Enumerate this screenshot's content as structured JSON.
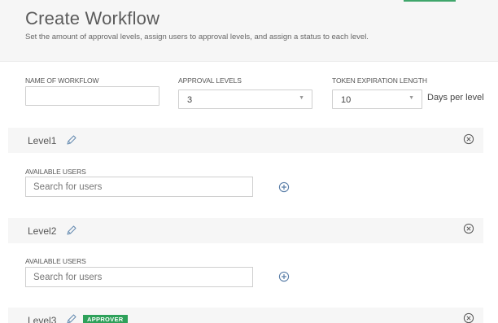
{
  "header": {
    "title": "Create Workflow",
    "subtitle": "Set the amount of approval levels, assign users to approval levels, and assign a status to each level."
  },
  "form": {
    "workflow_name_label": "NAME OF WORKFLOW",
    "workflow_name_value": "",
    "approval_levels_label": "APPROVAL LEVELS",
    "approval_levels_value": "3",
    "token_expiration_label": "TOKEN EXPIRATION LENGTH",
    "token_expiration_value": "10",
    "token_expiration_suffix": "Days per level"
  },
  "levels": [
    {
      "title": "Level1",
      "users_label": "AVAILABLE USERS",
      "search_placeholder": "Search for users"
    },
    {
      "title": "Level2",
      "users_label": "AVAILABLE USERS",
      "search_placeholder": "Search for users"
    },
    {
      "title": "Level3",
      "badge": "APPROVER"
    }
  ],
  "icons": {
    "edit": "pencil-icon",
    "remove": "close-circle-icon",
    "add": "plus-circle-icon",
    "dropdown": "chevron-down-icon"
  },
  "colors": {
    "header_bg": "#f6f6f6",
    "level_bar_bg": "#f6f6f6",
    "badge_bg": "#2ea15a",
    "icon_color": "#6a8fb3",
    "accent": "#3fa66b"
  }
}
